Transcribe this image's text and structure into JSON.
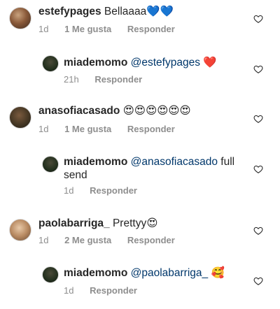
{
  "comments": [
    {
      "username": "estefypages",
      "text": "Bellaaaa",
      "emoji": "💙💙",
      "time": "1d",
      "likes": "1 Me gusta",
      "reply": "Responder"
    },
    {
      "username": "miademomo",
      "mention": "@estefypages",
      "emoji": "❤️",
      "time": "21h",
      "reply": "Responder"
    },
    {
      "username": "anasofiacasado",
      "emoji": "😍😍😍😍😍😍",
      "time": "1d",
      "likes": "1 Me gusta",
      "reply": "Responder"
    },
    {
      "username": "miademomo",
      "mention": "@anasofiacasado",
      "text": "full send",
      "time": "1d",
      "reply": "Responder"
    },
    {
      "username": "paolabarriga_",
      "text": "Prettyy",
      "emoji": "😍",
      "time": "1d",
      "likes": "2 Me gusta",
      "reply": "Responder"
    },
    {
      "username": "miademomo",
      "mention": "@paolabarriga_",
      "emoji": "🥰",
      "time": "1d",
      "reply": "Responder"
    }
  ],
  "icons": {
    "like": "heart-outline-icon",
    "avatar_default": "avatar"
  },
  "colors": {
    "mention": "#00376b",
    "meta": "#8e8e8e",
    "text": "#262626"
  }
}
